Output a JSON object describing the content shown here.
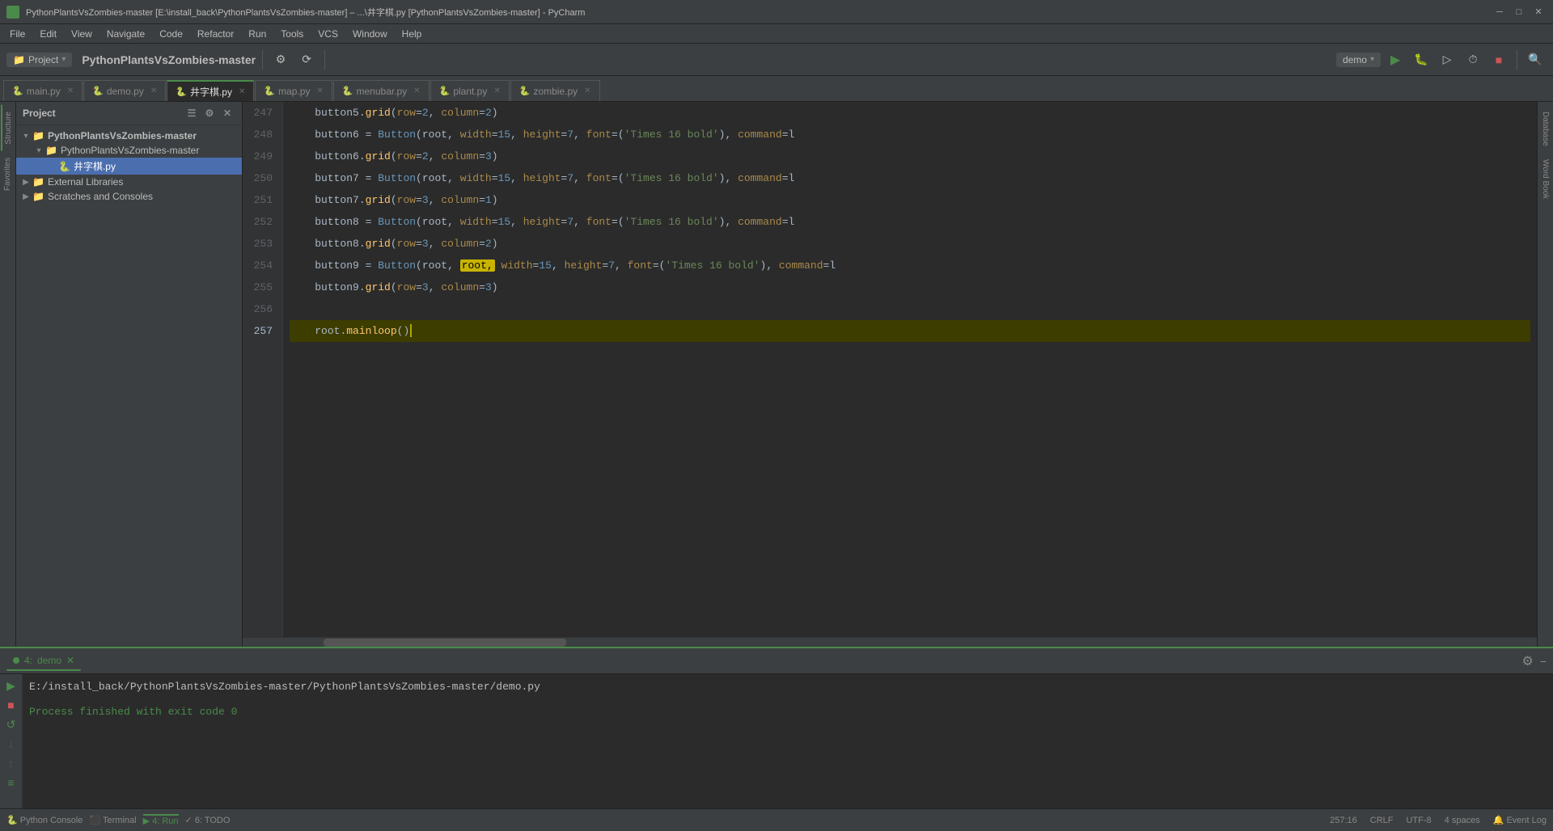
{
  "titlebar": {
    "title": "PythonPlantsVsZombies-master [E:\\install_back\\PythonPlantsVsZombies-master] – ...\\井字棋.py [PythonPlantsVsZombies-master] - PyCharm",
    "controls": [
      "minimize",
      "maximize",
      "close"
    ]
  },
  "menubar": {
    "items": [
      "File",
      "Edit",
      "View",
      "Navigate",
      "Code",
      "Refactor",
      "Run",
      "Tools",
      "VCS",
      "Window",
      "Help"
    ]
  },
  "toolbar": {
    "project_label": "Project",
    "project_name": "PythonPlantsVsZombies-master",
    "run_config": "demo"
  },
  "tabs": [
    {
      "label": "main.py",
      "active": false,
      "modified": false
    },
    {
      "label": "demo.py",
      "active": false,
      "modified": false
    },
    {
      "label": "井字棋.py",
      "active": true,
      "modified": false
    },
    {
      "label": "map.py",
      "active": false,
      "modified": false
    },
    {
      "label": "menubar.py",
      "active": false,
      "modified": false
    },
    {
      "label": "plant.py",
      "active": false,
      "modified": false
    },
    {
      "label": "zombie.py",
      "active": false,
      "modified": false
    }
  ],
  "sidebar": {
    "title": "Project",
    "items": [
      {
        "label": "PythonPlantsVsZombies-master",
        "type": "folder",
        "indent": 1,
        "expanded": true
      },
      {
        "label": "PythonPlantsVsZombies-master",
        "type": "folder",
        "indent": 2,
        "expanded": true
      },
      {
        "label": "井字棋.py",
        "type": "pyfile",
        "indent": 3,
        "selected": true
      },
      {
        "label": "External Libraries",
        "type": "folder",
        "indent": 1,
        "expanded": false
      },
      {
        "label": "Scratches and Consoles",
        "type": "folder",
        "indent": 1,
        "expanded": false
      }
    ]
  },
  "code": {
    "lines": [
      {
        "num": "247",
        "content": "button5.grid(row=2, column=2)",
        "highlight": false
      },
      {
        "num": "248",
        "content": "button6 = Button(root, width=15, height=7, font=('Times 16 bold'), command=l",
        "highlight": false
      },
      {
        "num": "249",
        "content": "button6.grid(row=2, column=3)",
        "highlight": false
      },
      {
        "num": "250",
        "content": "button7 = Button(root, width=15, height=7, font=('Times 16 bold'), command=l",
        "highlight": false
      },
      {
        "num": "251",
        "content": "button7.grid(row=3, column=1)",
        "highlight": false
      },
      {
        "num": "252",
        "content": "button8 = Button(root, width=15, height=7, font=('Times 16 bold'), command=l",
        "highlight": false
      },
      {
        "num": "253",
        "content": "button8.grid(row=3, column=2)",
        "highlight": false
      },
      {
        "num": "254",
        "content": "button9 = Button(root, width=15, height=7, font=('Times 16 bold'), command=l",
        "highlight": false
      },
      {
        "num": "255",
        "content": "button9.grid(row=3, column=3)",
        "highlight": false
      },
      {
        "num": "256",
        "content": "",
        "highlight": false
      },
      {
        "num": "257",
        "content": "root.mainloop()",
        "highlight": true,
        "is_current": true
      }
    ],
    "current_line": "257",
    "cursor_col": "16"
  },
  "run_panel": {
    "tab_label": "demo",
    "run_number": "4",
    "output_path": "E:/install_back/PythonPlantsVsZombies-master/PythonPlantsVsZombies-master/demo.py",
    "output_result": "Process finished with exit code 0"
  },
  "status": {
    "bottom_tabs": [
      "Python Console",
      "Terminal",
      "4: Run",
      "6: TODO"
    ],
    "active_bottom_tab": "4: Run",
    "line_col": "257:16",
    "line_separator": "CRLF",
    "encoding": "UTF-8",
    "indent": "4 spaces",
    "event_log": "Event Log"
  },
  "left_panel_tabs": [
    "Structure"
  ],
  "right_panel_tabs": [
    "Database",
    "Word Book"
  ],
  "icons": {
    "arrow_right": "▶",
    "arrow_down": "▼",
    "folder": "📁",
    "py_file": "🐍",
    "close": "✕",
    "minimize": "─",
    "maximize": "□",
    "settings": "⚙",
    "chevron": "▾",
    "run_green": "▶",
    "stop_red": "■",
    "rerun": "↺",
    "scroll_down": "↓",
    "scroll_up": "↑"
  }
}
